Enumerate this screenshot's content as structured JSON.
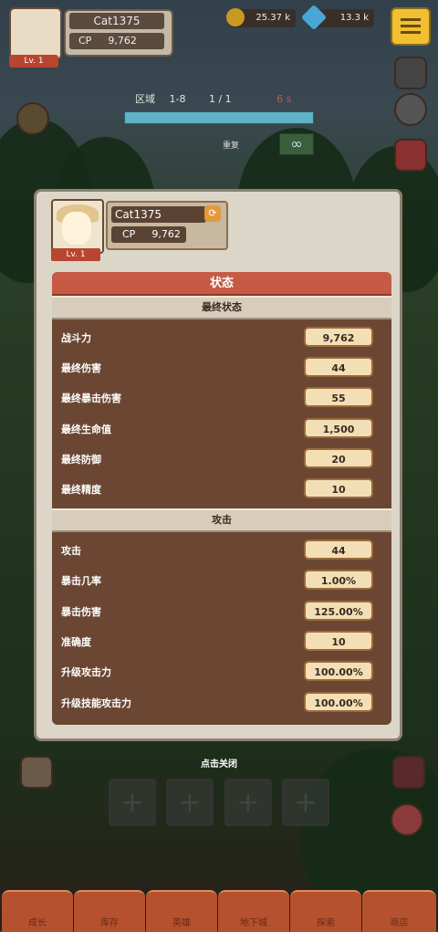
{
  "hud": {
    "level": "Lv. 1",
    "name": "Cat1375",
    "cp_label": "CP",
    "cp_value": "9,762",
    "gold": "25.37 k",
    "gems": "13.3 k"
  },
  "stage": {
    "label": "区域",
    "zone": "1-8",
    "wave": "1 / 1",
    "timer": "6 s",
    "repeat_label": "重复"
  },
  "modal": {
    "level": "Lv. 1",
    "name": "Cat1375",
    "cp_label": "CP",
    "cp_value": "9,762",
    "title": "状态",
    "final_section": "最终状态",
    "final_stats": [
      {
        "label": "战斗力",
        "value": "9,762"
      },
      {
        "label": "最终伤害",
        "value": "44"
      },
      {
        "label": "最终暴击伤害",
        "value": "55"
      },
      {
        "label": "最终生命值",
        "value": "1,500"
      },
      {
        "label": "最终防御",
        "value": "20"
      },
      {
        "label": "最终精度",
        "value": "10"
      }
    ],
    "attack_section": "攻击",
    "attack_stats": [
      {
        "label": "攻击",
        "value": "44"
      },
      {
        "label": "暴击几率",
        "value": "1.00%"
      },
      {
        "label": "暴击伤害",
        "value": "125.00%"
      },
      {
        "label": "准确度",
        "value": "10"
      },
      {
        "label": "升级攻击力",
        "value": "100.00%"
      },
      {
        "label": "升级技能攻击力",
        "value": "100.00%"
      }
    ]
  },
  "close_hint": "点击关闭",
  "bottom_nav": [
    "成长",
    "库存",
    "英雄",
    "地下城",
    "探索",
    "商店"
  ],
  "colors": {
    "accent": "#c65a45",
    "panel": "#6b4733",
    "value_bg": "#f3dfb6"
  }
}
